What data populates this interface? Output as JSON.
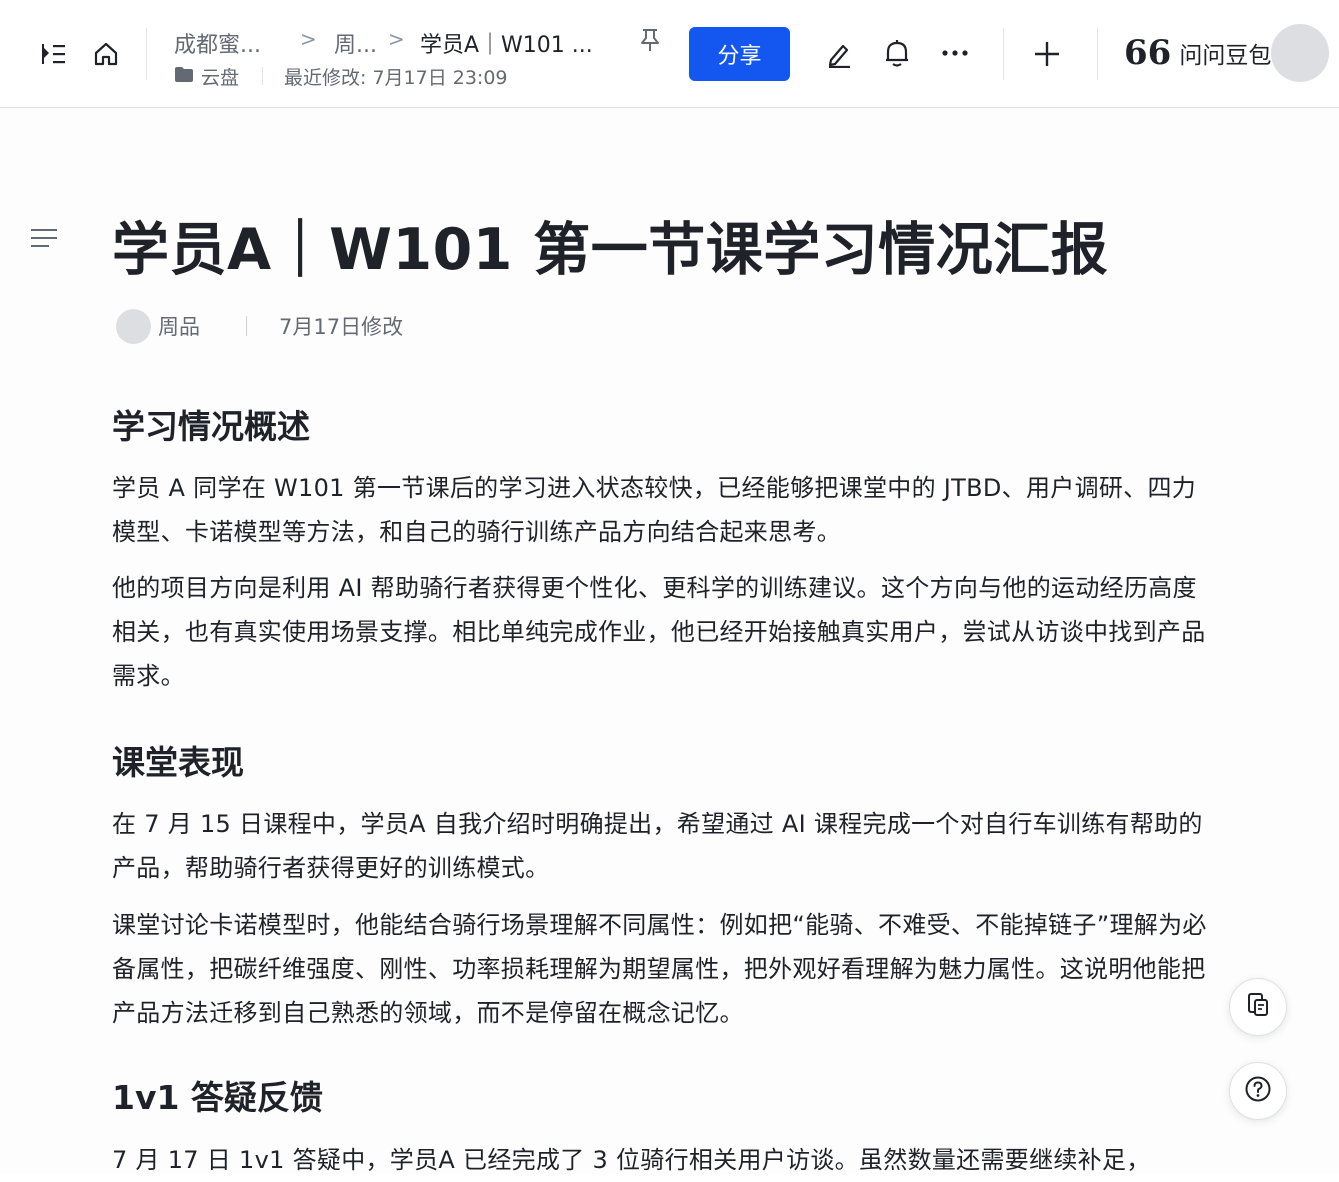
{
  "toolbar": {
    "breadcrumb": [
      "成都蜜...",
      "周...",
      "学员A｜W101 ..."
    ],
    "location": "云盘",
    "last_modified": "最近修改: 7月17日 23:09",
    "share_label": "分享",
    "ask_label": "问问豆包",
    "icons": [
      "expand-sidebar-icon",
      "home-icon",
      "folder-icon",
      "pin-icon",
      "edit-icon",
      "bell-icon",
      "more-icon",
      "plus-icon",
      "quote-icon"
    ],
    "accent_color": "#1456f0"
  },
  "doc": {
    "title": "学员A｜W101 第一节课学习情况汇报",
    "author": "周品",
    "modified": "7月17日修改",
    "sections": [
      {
        "heading": "学习情况概述",
        "paragraphs": [
          "学员 A 同学在 W101 第一节课后的学习进入状态较快，已经能够把课堂中的 JTBD、用户调研、四力模型、卡诺模型等方法，和自己的骑行训练产品方向结合起来思考。",
          "他的项目方向是利用 AI 帮助骑行者获得更个性化、更科学的训练建议。这个方向与他的运动经历高度相关，也有真实使用场景支撑。相比单纯完成作业，他已经开始接触真实用户，尝试从访谈中找到产品需求。"
        ]
      },
      {
        "heading": "课堂表现",
        "paragraphs": [
          "在 7 月 15 日课程中，学员A 自我介绍时明确提出，希望通过 AI 课程完成一个对自行车训练有帮助的产品，帮助骑行者获得更好的训练模式。",
          "课堂讨论卡诺模型时，他能结合骑行场景理解不同属性：例如把“能骑、不难受、不能掉链子”理解为必备属性，把碳纤维强度、刚性、功率损耗理解为期望属性，把外观好看理解为魅力属性。这说明他能把产品方法迁移到自己熟悉的领域，而不是停留在概念记忆。"
        ]
      },
      {
        "heading": "1v1 答疑反馈",
        "paragraphs": [
          "7 月 17 日 1v1 答疑中，学员A 已经完成了 3 位骑行相关用户访谈。虽然数量还需要继续补足，"
        ]
      }
    ]
  },
  "floating": {
    "icons": [
      "doc-outline-icon",
      "help-icon"
    ]
  }
}
